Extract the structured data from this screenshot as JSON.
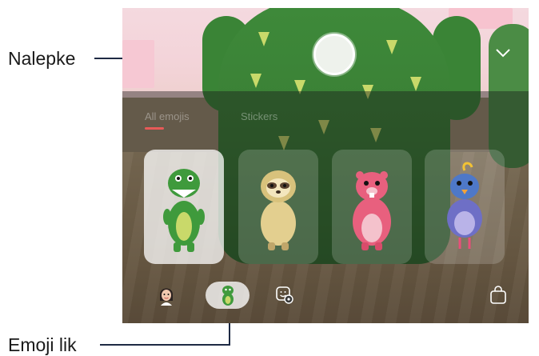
{
  "callouts": {
    "stickers": "Nalepke",
    "emoji_character": "Emoji lik"
  },
  "tabs": [
    {
      "label": "All emojis",
      "selected": true
    },
    {
      "label": "Stickers",
      "selected": false
    }
  ],
  "emoji_cards": [
    {
      "character": "green dinosaur",
      "selected": true
    },
    {
      "character": "sloth",
      "selected": false
    },
    {
      "character": "pink beaver",
      "selected": false
    },
    {
      "character": "blue bird",
      "selected": false
    }
  ],
  "bottom_bar": {
    "items": [
      "my-emoji-avatar",
      "character-emoji",
      "emoji-sticker-settings",
      "store"
    ],
    "selected": "character-emoji"
  },
  "colors": {
    "accent": "#e85a58",
    "dino_green": "#3a7f35",
    "callout_line": "#1e2a44"
  }
}
